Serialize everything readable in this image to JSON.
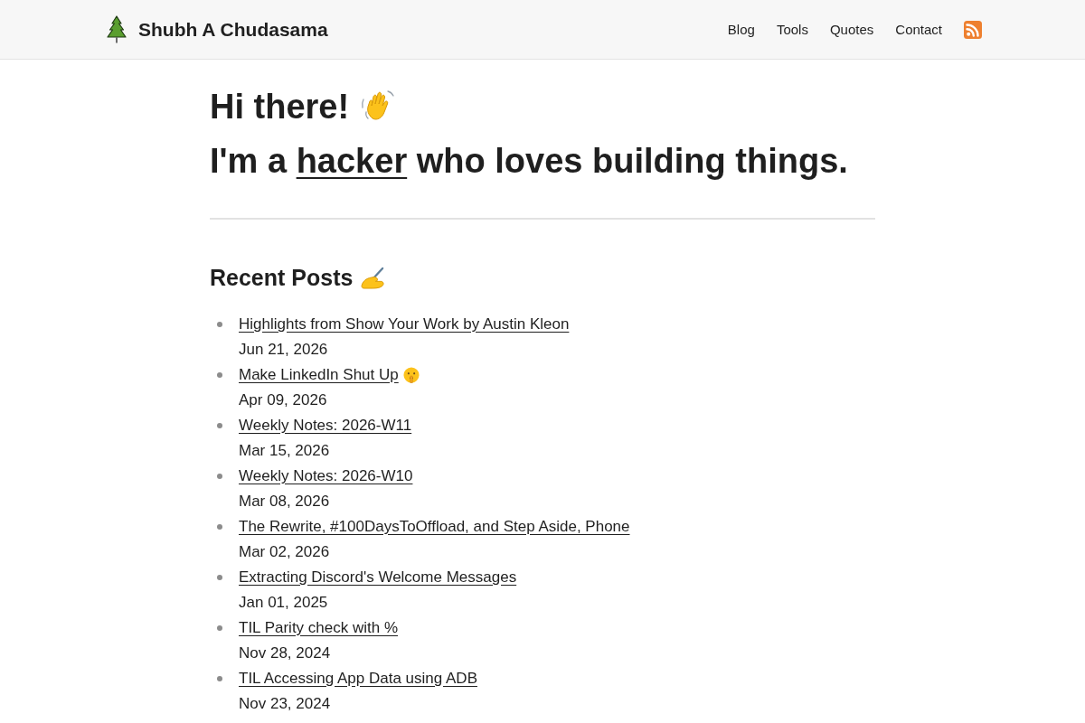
{
  "header": {
    "site_name": "Shubh A Chudasama",
    "nav": [
      "Blog",
      "Tools",
      "Quotes",
      "Contact"
    ]
  },
  "intro": {
    "greeting": "Hi there!",
    "tagline": {
      "before": "I'm a ",
      "link": "hacker",
      "after": " who loves building things."
    }
  },
  "recent_posts": {
    "title": "Recent Posts",
    "posts": [
      {
        "title": "Highlights from Show Your Work by Austin Kleon",
        "date": "Jun 21, 2026",
        "kind": "plain"
      },
      {
        "title": "Make LinkedIn Shut Up",
        "date": "Apr 09, 2026",
        "kind": "emoji"
      },
      {
        "title": "Weekly Notes: 2026-W11",
        "date": "Mar 15, 2026",
        "kind": "plain"
      },
      {
        "title": "Weekly Notes: 2026-W10",
        "date": "Mar 08, 2026",
        "kind": "plain"
      },
      {
        "title": "The Rewrite, #100DaysToOffload, and Step Aside, Phone",
        "date": "Mar 02, 2026",
        "kind": "plain"
      },
      {
        "title": "Extracting Discord's Welcome Messages",
        "date": "Jan 01, 2025",
        "kind": "plain"
      },
      {
        "title": "TIL Parity check with %",
        "date": "Nov 28, 2024",
        "kind": "plain"
      },
      {
        "title": "TIL Accessing App Data using ADB",
        "date": "Nov 23, 2024",
        "kind": "plain"
      }
    ]
  }
}
